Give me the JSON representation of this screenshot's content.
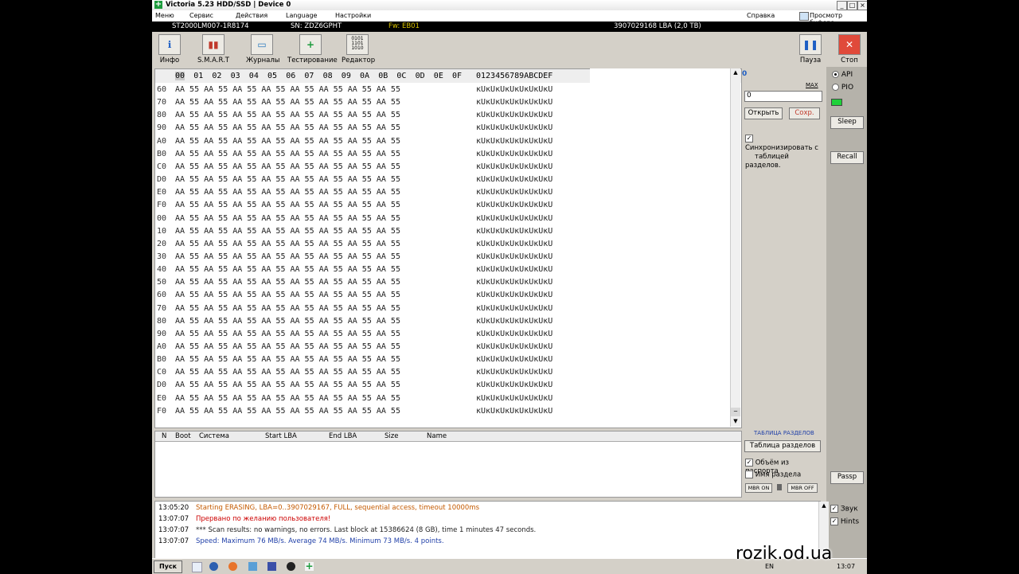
{
  "window": {
    "title": "Victoria 5.23 HDD/SSD | Device 0",
    "min": "_",
    "max": "□",
    "close": "×"
  },
  "menu": {
    "items": [
      "Меню",
      "Сервис",
      "Действия",
      "Language",
      "Настройки"
    ],
    "help": "Справка",
    "clipboard": "Просмотр буфера"
  },
  "drive": {
    "model": "ST2000LM007-1R8174",
    "serial": "SN: ZDZ6GPHT",
    "firmware": "Fw: EB01",
    "capacity": "3907029168 LBA (2,0 TB)"
  },
  "toolbar": {
    "buttons": [
      {
        "label": "Инфо",
        "icon": "info-icon"
      },
      {
        "label": "S.M.A.R.T",
        "icon": "smart-chart-icon"
      },
      {
        "label": "Журналы",
        "icon": "folder-icon"
      },
      {
        "label": "Тестирование",
        "icon": "plus-test-icon"
      },
      {
        "label": "Редактор",
        "icon": "binary-editor-icon"
      }
    ],
    "pause": "Пауза",
    "stop": "Стоп"
  },
  "hex": {
    "columns": [
      "00",
      "01",
      "02",
      "03",
      "04",
      "05",
      "06",
      "07",
      "08",
      "09",
      "0A",
      "0B",
      "0C",
      "0D",
      "0E",
      "0F"
    ],
    "ascii_header": "0123456789ABCDEF",
    "offsets": [
      "60",
      "70",
      "80",
      "90",
      "A0",
      "B0",
      "C0",
      "D0",
      "E0",
      "F0",
      "00",
      "10",
      "20",
      "30",
      "40",
      "50",
      "60",
      "70",
      "80",
      "90",
      "A0",
      "B0",
      "C0",
      "D0",
      "E0",
      "F0"
    ],
    "bytes": "AA 55 AA 55 AA 55 AA 55 AA 55 AA 55 AA 55 AA 55",
    "ascii": "кUкUкUкUкUкUкUкU"
  },
  "side": {
    "sector_value": "0",
    "max_label": "MAX",
    "sector_input": "0",
    "open": "Открыть",
    "save": "Сохр.",
    "sync_label_1": "Синхронизировать с",
    "sync_label_2": "таблицей разделов.",
    "api": "API",
    "pio": "PIO",
    "sleep": "Sleep",
    "recall": "Recall",
    "passp": "Passp",
    "sound": "Звук",
    "hints": "Hints"
  },
  "partitions": {
    "headers": [
      "N",
      "Boot",
      "Система",
      "Start LBA",
      "End LBA",
      "Size",
      "Name"
    ],
    "section_title": "ТАБЛИЦА РАЗДЕЛОВ",
    "table_button": "Таблица разделов",
    "volume_passport": "Объём из паспорта",
    "partition_name": "Имя раздела",
    "mbr_on": "MBR ON",
    "mbr_off": "MBR OFF"
  },
  "log": [
    {
      "time": "13:05:20",
      "text": "Starting ERASING, LBA=0..3907029167, FULL, sequential access, timeout 10000ms",
      "color": "#c45a00"
    },
    {
      "time": "13:07:07",
      "text": "Прервано по желанию пользователя!",
      "color": "#cc0000"
    },
    {
      "time": "13:07:07",
      "text": "*** Scan results: no warnings, no errors. Last block at 15386624 (8 GB), time 1 minutes 47 seconds.",
      "color": "#222222"
    },
    {
      "time": "13:07:07",
      "text": "Speed: Maximum 76 MB/s. Average 74 MB/s. Minimum 73 MB/s. 4 points.",
      "color": "#1f3fa8"
    }
  ],
  "taskbar": {
    "start": "Пуск",
    "lang": "EN",
    "clock": "13:07"
  },
  "watermark": "rozik.od.ua"
}
